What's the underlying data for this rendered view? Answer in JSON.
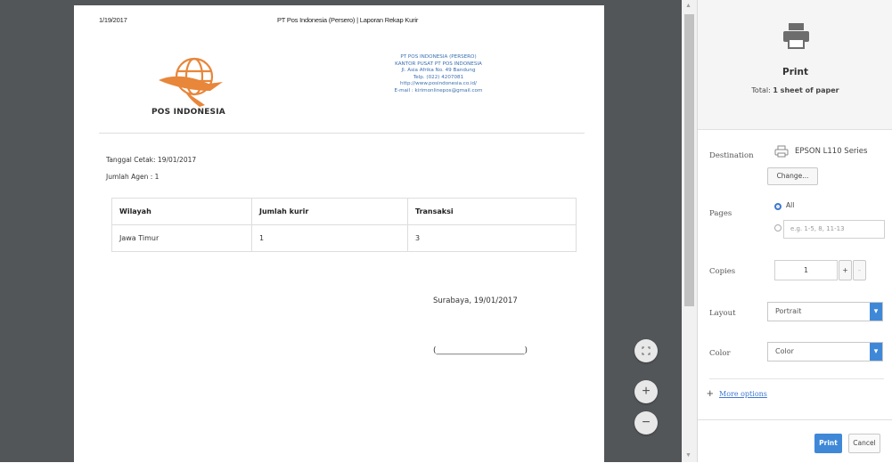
{
  "preview": {
    "page_date": "1/19/2017",
    "page_title": "PT Pos Indonesia (Persero) | Laporan Rekap Kurir",
    "logo_text": "POS INDONESIA",
    "address_lines": [
      "PT POS INDONESIA (PERSERO)",
      "KANTOR PUSAT PT POS INDONESIA",
      "Jl. Asia Afrika No. 49 Bandung",
      "Telp. (022) 4207081",
      "http://www.posindonesia.co.id/",
      "E-mail : kirimonlinepos@gmail.com"
    ],
    "tanggal_cetak": "Tanggal Cetak: 19/01/2017",
    "jumlah_agen": "Jumlah Agen : 1",
    "table": {
      "headers": [
        "Wilayah",
        "Jumlah kurir",
        "Transaksi"
      ],
      "rows": [
        [
          "Jawa Timur",
          "1",
          "3"
        ]
      ]
    },
    "sign_city_date": "Surabaya, 19/01/2017",
    "sign_line": "(______________________)"
  },
  "zoom": {
    "fit_icon": "fit-to-page-icon",
    "zoom_in": "+",
    "zoom_out": "−"
  },
  "sidebar": {
    "title": "Print",
    "total_prefix": "Total: ",
    "total_value": "1 sheet of paper",
    "destination_label": "Destination",
    "destination_value": "EPSON L110 Series",
    "change_button": "Change...",
    "pages_label": "Pages",
    "pages_all": "All",
    "pages_placeholder": "e.g. 1-5, 8, 11-13",
    "copies_label": "Copies",
    "copies_value": "1",
    "copies_plus": "+",
    "copies_minus": "–",
    "layout_label": "Layout",
    "layout_value": "Portrait",
    "color_label": "Color",
    "color_value": "Color",
    "more_options": "More options",
    "print_button": "Print",
    "cancel_button": "Cancel"
  },
  "colors": {
    "accent": "#3f88d8",
    "logo_orange": "#e8863a",
    "preview_bg": "#525659"
  }
}
